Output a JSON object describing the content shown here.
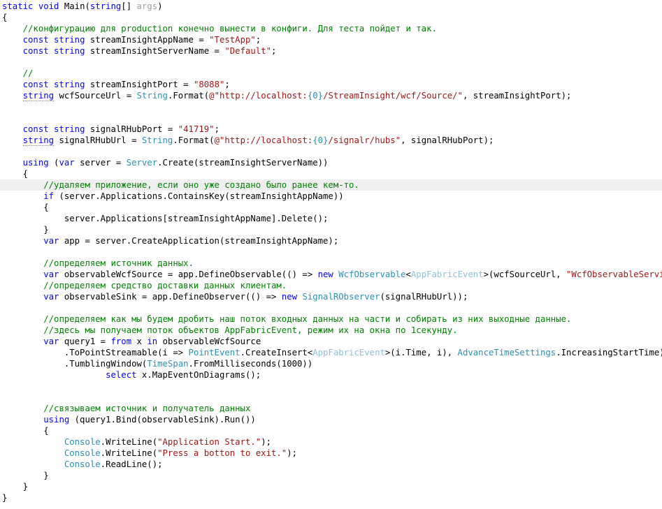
{
  "editor": {
    "language": "csharp",
    "theme": "visual-studio-light",
    "background_color": "#ffffff",
    "highlight_line_color": "#efefef",
    "colors": {
      "keyword": "#0000ff",
      "type": "#2b91af",
      "generic_argument": "#8fc0d4",
      "string": "#a31515",
      "comment": "#008000",
      "plain": "#000000",
      "unused_identifier": "#a0a0a0"
    }
  },
  "code": {
    "lines": [
      {
        "n": 1,
        "indent": 0,
        "highlight": false,
        "tokens": [
          {
            "t": "static ",
            "c": "kw"
          },
          {
            "t": "void ",
            "c": "kw"
          },
          {
            "t": "Main(",
            "c": "pln"
          },
          {
            "t": "string",
            "c": "kw"
          },
          {
            "t": "[] ",
            "c": "pln"
          },
          {
            "t": "args",
            "c": "dim"
          },
          {
            "t": ")",
            "c": "pln"
          }
        ]
      },
      {
        "n": 2,
        "indent": 0,
        "highlight": false,
        "tokens": [
          {
            "t": "{",
            "c": "pln"
          }
        ]
      },
      {
        "n": 3,
        "indent": 1,
        "highlight": false,
        "tokens": [
          {
            "t": "//конфигурацию для production конечно вынести в конфиги. Для теста пойдет и так.",
            "c": "cmt"
          }
        ]
      },
      {
        "n": 4,
        "indent": 1,
        "highlight": false,
        "tokens": [
          {
            "t": "const ",
            "c": "kw"
          },
          {
            "t": "string ",
            "c": "kw"
          },
          {
            "t": "streamInsightAppName = ",
            "c": "pln"
          },
          {
            "t": "\"TestApp\"",
            "c": "str"
          },
          {
            "t": ";",
            "c": "pln"
          }
        ]
      },
      {
        "n": 5,
        "indent": 1,
        "highlight": false,
        "tokens": [
          {
            "t": "const ",
            "c": "kw"
          },
          {
            "t": "string ",
            "c": "kw"
          },
          {
            "t": "streamInsightServerName = ",
            "c": "pln"
          },
          {
            "t": "\"Default\"",
            "c": "str"
          },
          {
            "t": ";",
            "c": "pln"
          }
        ]
      },
      {
        "n": 6,
        "indent": 0,
        "highlight": false,
        "tokens": []
      },
      {
        "n": 7,
        "indent": 1,
        "highlight": false,
        "tokens": [
          {
            "t": "//",
            "c": "cmt"
          }
        ]
      },
      {
        "n": 8,
        "indent": 1,
        "highlight": false,
        "tokens": [
          {
            "t": "const ",
            "c": "kw"
          },
          {
            "t": "string ",
            "c": "kw"
          },
          {
            "t": "streamInsightPort = ",
            "c": "pln"
          },
          {
            "t": "\"8088\"",
            "c": "str"
          },
          {
            "t": ";",
            "c": "pln"
          }
        ]
      },
      {
        "n": 9,
        "indent": 1,
        "highlight": false,
        "tokens": [
          {
            "t": "string",
            "c": "kw sq"
          },
          {
            "t": " wcfSourceUrl = ",
            "c": "pln"
          },
          {
            "t": "String",
            "c": "type"
          },
          {
            "t": ".Format(",
            "c": "pln"
          },
          {
            "t": "@\"http://localhost:",
            "c": "str"
          },
          {
            "t": "{0}",
            "c": "fmt"
          },
          {
            "t": "/StreamInsight/wcf/Source/\"",
            "c": "str"
          },
          {
            "t": ", streamInsightPort);",
            "c": "pln"
          }
        ]
      },
      {
        "n": 10,
        "indent": 0,
        "highlight": false,
        "tokens": []
      },
      {
        "n": 11,
        "indent": 0,
        "highlight": false,
        "tokens": []
      },
      {
        "n": 12,
        "indent": 1,
        "highlight": false,
        "tokens": [
          {
            "t": "const ",
            "c": "kw"
          },
          {
            "t": "string ",
            "c": "kw"
          },
          {
            "t": "signalRHubPort = ",
            "c": "pln"
          },
          {
            "t": "\"41719\"",
            "c": "str"
          },
          {
            "t": ";",
            "c": "pln"
          }
        ]
      },
      {
        "n": 13,
        "indent": 1,
        "highlight": false,
        "tokens": [
          {
            "t": "string",
            "c": "kw sq"
          },
          {
            "t": " signalRHubUrl = ",
            "c": "pln"
          },
          {
            "t": "String",
            "c": "type"
          },
          {
            "t": ".Format(",
            "c": "pln"
          },
          {
            "t": "@\"http://localhost:",
            "c": "str"
          },
          {
            "t": "{0}",
            "c": "fmt"
          },
          {
            "t": "/signalr/hubs\"",
            "c": "str"
          },
          {
            "t": ", signalRHubPort);",
            "c": "pln"
          }
        ]
      },
      {
        "n": 14,
        "indent": 0,
        "highlight": false,
        "tokens": []
      },
      {
        "n": 15,
        "indent": 1,
        "highlight": false,
        "tokens": [
          {
            "t": "using ",
            "c": "kw"
          },
          {
            "t": "(",
            "c": "pln"
          },
          {
            "t": "var ",
            "c": "kw"
          },
          {
            "t": "server = ",
            "c": "pln"
          },
          {
            "t": "Server",
            "c": "type"
          },
          {
            "t": ".Create(streamInsightServerName))",
            "c": "pln"
          }
        ]
      },
      {
        "n": 16,
        "indent": 1,
        "highlight": false,
        "tokens": [
          {
            "t": "{",
            "c": "pln"
          }
        ]
      },
      {
        "n": 17,
        "indent": 2,
        "highlight": true,
        "tokens": [
          {
            "t": "//удаляем приложение, если оно уже создано было ранее кем-то.",
            "c": "cmt"
          }
        ]
      },
      {
        "n": 18,
        "indent": 2,
        "highlight": false,
        "tokens": [
          {
            "t": "if ",
            "c": "kw"
          },
          {
            "t": "(server.Applications.ContainsKey(streamInsightAppName))",
            "c": "pln"
          }
        ]
      },
      {
        "n": 19,
        "indent": 2,
        "highlight": false,
        "tokens": [
          {
            "t": "{",
            "c": "pln"
          }
        ]
      },
      {
        "n": 20,
        "indent": 3,
        "highlight": false,
        "tokens": [
          {
            "t": "server.Applications[streamInsightAppName].Delete();",
            "c": "pln"
          }
        ]
      },
      {
        "n": 21,
        "indent": 2,
        "highlight": false,
        "tokens": [
          {
            "t": "}",
            "c": "pln"
          }
        ]
      },
      {
        "n": 22,
        "indent": 2,
        "highlight": false,
        "tokens": [
          {
            "t": "var ",
            "c": "kw"
          },
          {
            "t": "app = server.CreateApplication(streamInsightAppName);",
            "c": "pln"
          }
        ]
      },
      {
        "n": 23,
        "indent": 0,
        "highlight": false,
        "tokens": []
      },
      {
        "n": 24,
        "indent": 2,
        "highlight": false,
        "tokens": [
          {
            "t": "//определяем источник данных.",
            "c": "cmt"
          }
        ]
      },
      {
        "n": 25,
        "indent": 2,
        "highlight": false,
        "tokens": [
          {
            "t": "var ",
            "c": "kw"
          },
          {
            "t": "observableWcfSource = app.DefineObservable(() => ",
            "c": "pln"
          },
          {
            "t": "new ",
            "c": "kw"
          },
          {
            "t": "WcfObservable",
            "c": "type"
          },
          {
            "t": "<",
            "c": "pln"
          },
          {
            "t": "AppFabricEvent",
            "c": "gen"
          },
          {
            "t": ">(wcfSourceUrl, ",
            "c": "pln"
          },
          {
            "t": "\"WcfObservableService\"",
            "c": "str"
          },
          {
            "t": "));",
            "c": "pln"
          }
        ]
      },
      {
        "n": 26,
        "indent": 2,
        "highlight": false,
        "tokens": [
          {
            "t": "//определяем средство доставки данных клиентам.",
            "c": "cmt"
          }
        ]
      },
      {
        "n": 27,
        "indent": 2,
        "highlight": false,
        "tokens": [
          {
            "t": "var ",
            "c": "kw"
          },
          {
            "t": "observableSink = app.DefineObserver(() => ",
            "c": "pln"
          },
          {
            "t": "new ",
            "c": "kw"
          },
          {
            "t": "SignalRObserver",
            "c": "type"
          },
          {
            "t": "(signalRHubUrl));",
            "c": "pln"
          }
        ]
      },
      {
        "n": 28,
        "indent": 0,
        "highlight": false,
        "tokens": []
      },
      {
        "n": 29,
        "indent": 2,
        "highlight": false,
        "tokens": [
          {
            "t": "//определяем как мы будем дробить наш поток входных данных на части и собирать из них выходные данные.",
            "c": "cmt"
          }
        ]
      },
      {
        "n": 30,
        "indent": 2,
        "highlight": false,
        "tokens": [
          {
            "t": "//здесь мы получаем поток объектов AppFabricEvent, режим их на окна по 1секунду.",
            "c": "cmt"
          }
        ]
      },
      {
        "n": 31,
        "indent": 2,
        "highlight": false,
        "tokens": [
          {
            "t": "var ",
            "c": "kw"
          },
          {
            "t": "query1 = ",
            "c": "pln"
          },
          {
            "t": "from ",
            "c": "kw"
          },
          {
            "t": "x ",
            "c": "pln"
          },
          {
            "t": "in ",
            "c": "kw"
          },
          {
            "t": "observableWcfSource",
            "c": "pln"
          }
        ]
      },
      {
        "n": 32,
        "indent": 3,
        "highlight": false,
        "tokens": [
          {
            "t": ".ToPointStreamable(i => ",
            "c": "pln"
          },
          {
            "t": "PointEvent",
            "c": "type"
          },
          {
            "t": ".CreateInsert<",
            "c": "pln"
          },
          {
            "t": "AppFabricEvent",
            "c": "gen"
          },
          {
            "t": ">(i.Time, i), ",
            "c": "pln"
          },
          {
            "t": "AdvanceTimeSettings",
            "c": "type"
          },
          {
            "t": ".IncreasingStartTime)",
            "c": "pln"
          }
        ]
      },
      {
        "n": 33,
        "indent": 3,
        "highlight": false,
        "tokens": [
          {
            "t": ".TumblingWindow(",
            "c": "pln"
          },
          {
            "t": "TimeSpan",
            "c": "type"
          },
          {
            "t": ".FromMilliseconds(1000))",
            "c": "pln"
          }
        ]
      },
      {
        "n": 34,
        "indent": 5,
        "highlight": false,
        "tokens": [
          {
            "t": "select ",
            "c": "kw"
          },
          {
            "t": "x.MapEventOnDiagrams();",
            "c": "pln"
          }
        ]
      },
      {
        "n": 35,
        "indent": 0,
        "highlight": false,
        "tokens": []
      },
      {
        "n": 36,
        "indent": 0,
        "highlight": false,
        "tokens": []
      },
      {
        "n": 37,
        "indent": 2,
        "highlight": false,
        "tokens": [
          {
            "t": "//связываем источник и получатель данных",
            "c": "cmt"
          }
        ]
      },
      {
        "n": 38,
        "indent": 2,
        "highlight": false,
        "tokens": [
          {
            "t": "using ",
            "c": "kw"
          },
          {
            "t": "(query1.Bind(observableSink).Run())",
            "c": "pln"
          }
        ]
      },
      {
        "n": 39,
        "indent": 2,
        "highlight": false,
        "tokens": [
          {
            "t": "{",
            "c": "pln"
          }
        ]
      },
      {
        "n": 40,
        "indent": 3,
        "highlight": false,
        "tokens": [
          {
            "t": "Console",
            "c": "type"
          },
          {
            "t": ".WriteLine(",
            "c": "pln"
          },
          {
            "t": "\"Application Start.\"",
            "c": "str"
          },
          {
            "t": ");",
            "c": "pln"
          }
        ]
      },
      {
        "n": 41,
        "indent": 3,
        "highlight": false,
        "tokens": [
          {
            "t": "Console",
            "c": "type"
          },
          {
            "t": ".WriteLine(",
            "c": "pln"
          },
          {
            "t": "\"Press a botton to exit.\"",
            "c": "str"
          },
          {
            "t": ");",
            "c": "pln"
          }
        ]
      },
      {
        "n": 42,
        "indent": 3,
        "highlight": false,
        "tokens": [
          {
            "t": "Console",
            "c": "type"
          },
          {
            "t": ".ReadLine();",
            "c": "pln"
          }
        ]
      },
      {
        "n": 43,
        "indent": 2,
        "highlight": false,
        "tokens": [
          {
            "t": "}",
            "c": "pln"
          }
        ]
      },
      {
        "n": 44,
        "indent": 1,
        "highlight": false,
        "tokens": [
          {
            "t": "}",
            "c": "pln"
          }
        ]
      },
      {
        "n": 45,
        "indent": 0,
        "highlight": false,
        "tokens": [
          {
            "t": "}",
            "c": "pln"
          }
        ]
      }
    ]
  }
}
